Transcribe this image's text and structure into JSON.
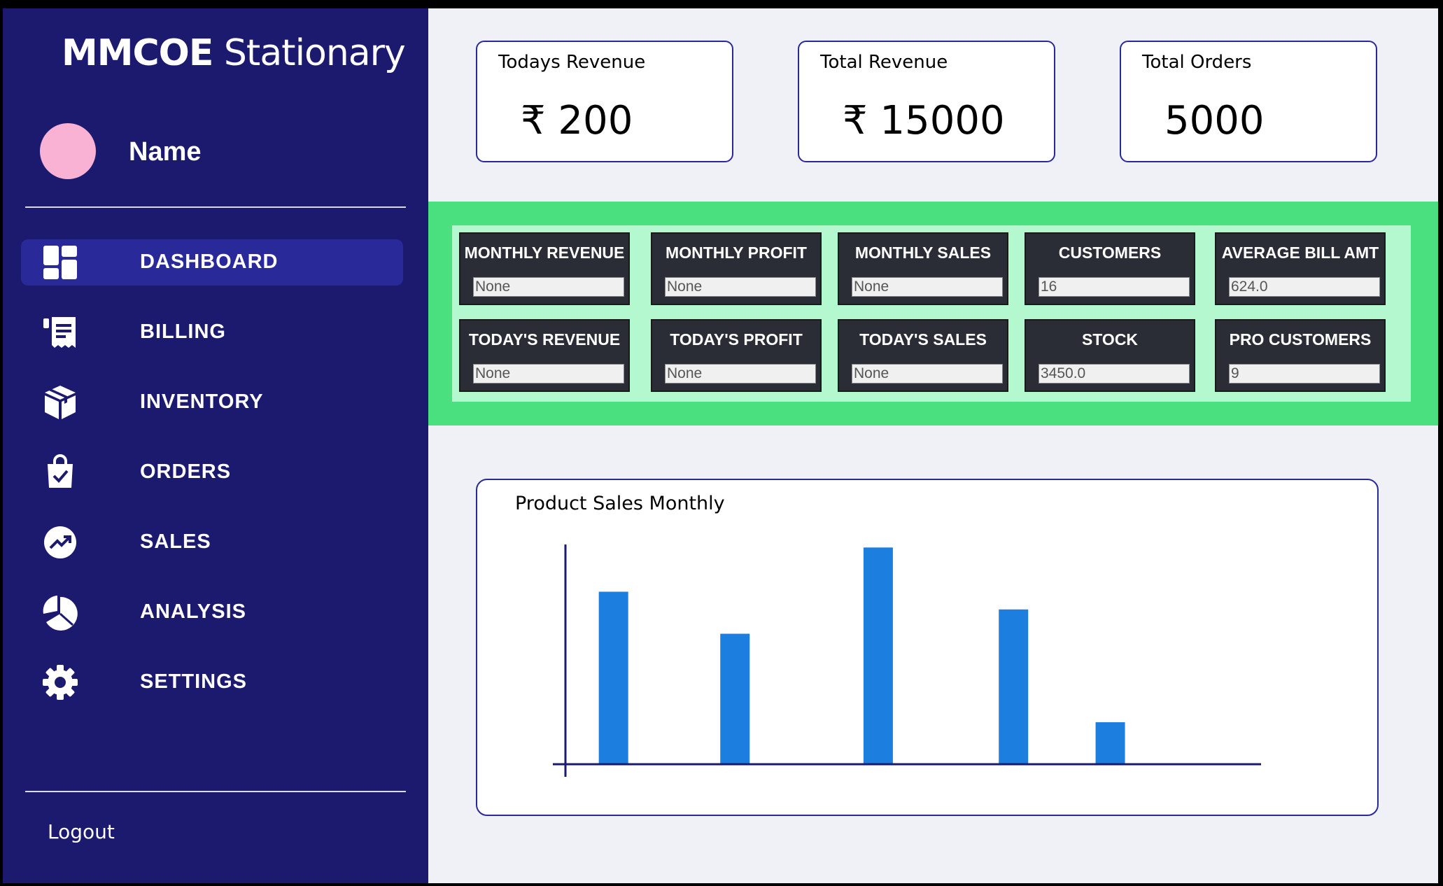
{
  "sidebar": {
    "brand_bold": "MMCOE",
    "brand_light": " Stationary",
    "user_name": "Name",
    "nav": [
      {
        "label": "DASHBOARD",
        "icon": "dashboard-icon",
        "active": true
      },
      {
        "label": "BILLING",
        "icon": "receipt-icon"
      },
      {
        "label": "INVENTORY",
        "icon": "box-icon"
      },
      {
        "label": "ORDERS",
        "icon": "shopping-bag-check-icon"
      },
      {
        "label": "SALES",
        "icon": "trending-up-icon"
      },
      {
        "label": "ANALYSIS",
        "icon": "pie-chart-icon"
      },
      {
        "label": "SETTINGS",
        "icon": "gear-icon"
      }
    ],
    "logout": "Logout"
  },
  "cards": [
    {
      "label": "Todays Revenue",
      "value": "₹ 200"
    },
    {
      "label": "Total Revenue",
      "value": "₹ 15000"
    },
    {
      "label": "Total Orders",
      "value": "5000"
    }
  ],
  "stats": [
    {
      "title": "MONTHLY REVENUE",
      "value": "None"
    },
    {
      "title": "MONTHLY PROFIT",
      "value": "None"
    },
    {
      "title": "MONTHLY SALES",
      "value": "None"
    },
    {
      "title": "CUSTOMERS",
      "value": "16"
    },
    {
      "title": "AVERAGE BILL AMT",
      "value": "624.0"
    },
    {
      "title": "TODAY'S REVENUE",
      "value": "None"
    },
    {
      "title": "TODAY'S PROFIT",
      "value": "None"
    },
    {
      "title": "TODAY'S SALES",
      "value": "None"
    },
    {
      "title": "STOCK",
      "value": "3450.0"
    },
    {
      "title": "PRO CUSTOMERS",
      "value": "9"
    }
  ],
  "colors": {
    "sidebar_bg": "#1b1a6e",
    "nav_active": "#29299a",
    "band_green": "#4ae080",
    "band_inner": "#b4f8d0",
    "tile_dark": "#2a2d36",
    "bar_blue": "#1c7fe0",
    "axis": "#1b1a6e"
  },
  "chart": {
    "title": "Product Sales Monthly"
  },
  "chart_data": {
    "type": "bar",
    "title": "Product Sales Monthly",
    "x": [
      1,
      2,
      3,
      4,
      5
    ],
    "values": [
      78,
      59,
      98,
      70,
      19
    ],
    "xlim": [
      0.4,
      7.5
    ],
    "ylim": [
      0,
      100
    ],
    "xlabel": "",
    "ylabel": "",
    "grid": false,
    "tick_labels_shown": false
  }
}
